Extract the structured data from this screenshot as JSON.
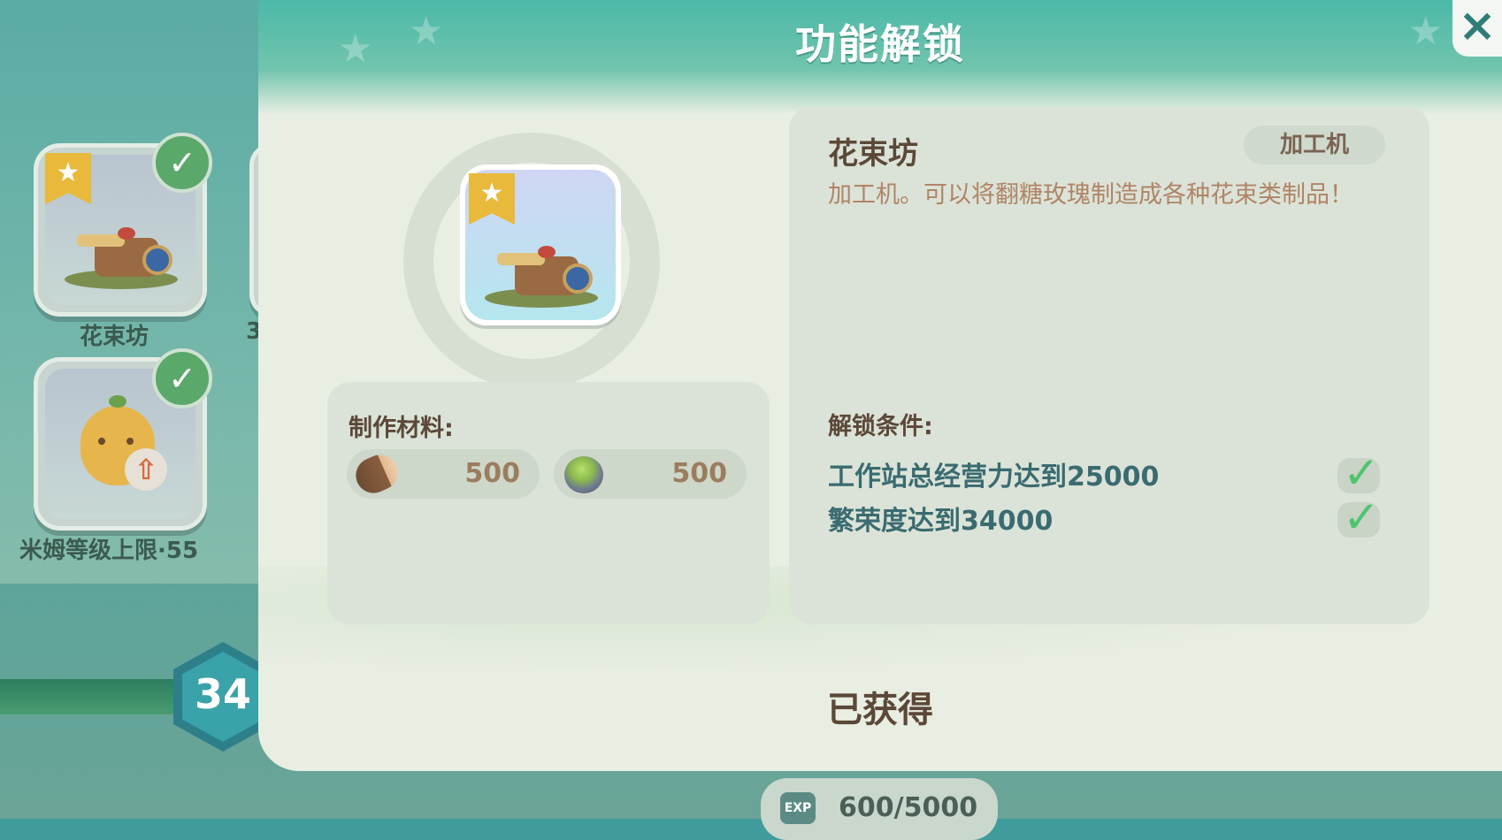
{
  "background": {
    "cards": [
      {
        "label": "花束坊",
        "checked": true,
        "starred": true
      },
      {
        "label": "米姆等级上限·55",
        "checked": true,
        "starred": false
      }
    ],
    "partial_label": "3",
    "level": "34",
    "exp": {
      "icon_label": "EXP",
      "text": "600/5000"
    }
  },
  "dialog": {
    "title": "功能解锁",
    "close_icon": "×",
    "item": {
      "name": "花束坊",
      "icon": "flower-workshop-building",
      "starred": true
    },
    "materials": {
      "label": "制作材料:",
      "items": [
        {
          "icon": "wood-log-icon",
          "amount": "500"
        },
        {
          "icon": "green-stone-icon",
          "amount": "500"
        }
      ]
    },
    "info": {
      "name": "花束坊",
      "type_tag": "加工机",
      "description": "加工机。可以将翻糖玫瑰制造成各种花束类制品！",
      "conditions_label": "解锁条件:",
      "conditions": [
        {
          "text": "工作站总经营力达到25000",
          "met": true
        },
        {
          "text": "繁荣度达到34000",
          "met": true
        }
      ]
    },
    "status": "已获得"
  },
  "colors": {
    "header": "#4bb9a8",
    "panel": "#e9eee3",
    "brown_text": "#5b4838",
    "condition_text": "#3a6b70",
    "check_green": "#4fc46f"
  }
}
